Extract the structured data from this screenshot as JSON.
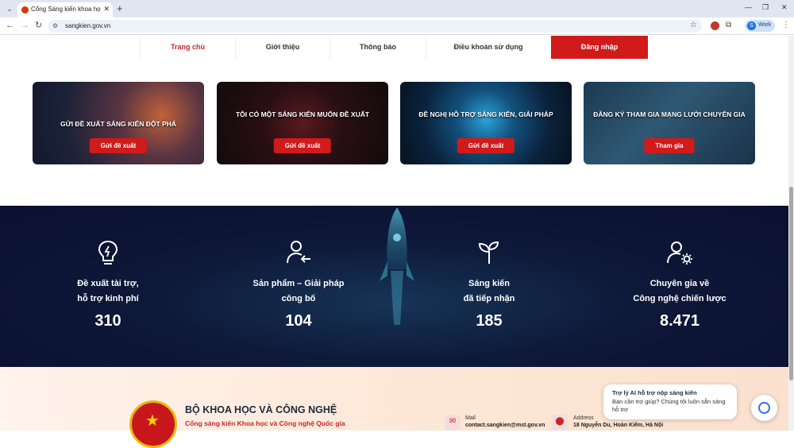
{
  "browser": {
    "tab_title": "Cổng Sáng kiến khoa học, công",
    "url": "sangkien.gov.vn",
    "profile_label": "Work",
    "profile_initial": "S"
  },
  "nav": {
    "items": [
      {
        "label": "Trang chủ"
      },
      {
        "label": "Giới thiệu"
      },
      {
        "label": "Thông báo"
      },
      {
        "label": "Điều khoản sử dụng"
      },
      {
        "label": "Đăng nhập"
      }
    ]
  },
  "cards": [
    {
      "title": "GỬI ĐỀ XUẤT SÁNG KIẾN ĐỘT PHÁ",
      "button": "Gửi đề xuất"
    },
    {
      "title": "TÔI CÓ MỘT SÁNG KIẾN MUỐN ĐỀ XUẤT",
      "button": "Gửi đề xuất"
    },
    {
      "title": "ĐỀ NGHỊ HỖ TRỢ SÁNG KIẾN, GIẢI PHÁP",
      "button": "Gửi đề xuất"
    },
    {
      "title": "ĐĂNG KÝ THAM GIA MẠNG LƯỚI CHUYÊN GIA",
      "button": "Tham gia"
    }
  ],
  "stats": [
    {
      "line1": "Đề xuất tài trợ,",
      "line2": "hỗ trợ kinh phí",
      "value": "310",
      "icon": "lightbulb-icon"
    },
    {
      "line1": "Sản phẩm – Giải pháp",
      "line2": "công bố",
      "value": "104",
      "icon": "user-arrow-icon"
    },
    {
      "line1": "Sáng kiến",
      "line2": "đã tiếp nhận",
      "value": "185",
      "icon": "sprout-icon"
    },
    {
      "line1": "Chuyên gia về",
      "line2": "Công nghệ chiến lược",
      "value": "8.471",
      "icon": "user-gear-icon"
    }
  ],
  "footer": {
    "ministry": "BỘ KHOA HỌC VÀ CÔNG NGHỆ",
    "portal": "Cổng sáng kiến Khoa học và Công nghệ Quốc gia",
    "mail_label": "Mail",
    "mail_value": "contact.sangkien@mst.gov.vn",
    "address_label": "Address",
    "address_value": "18 Nguyễn Du, Hoàn Kiếm, Hà Nội"
  },
  "chat": {
    "title": "Trợ lý AI hỗ trợ nộp sáng kiến",
    "text": "Bạn cần trợ giúp? Chúng tôi luôn sẵn sàng hỗ trợ"
  },
  "colors": {
    "brand_red": "#d11a1a",
    "stats_bg": "#0e1838"
  }
}
